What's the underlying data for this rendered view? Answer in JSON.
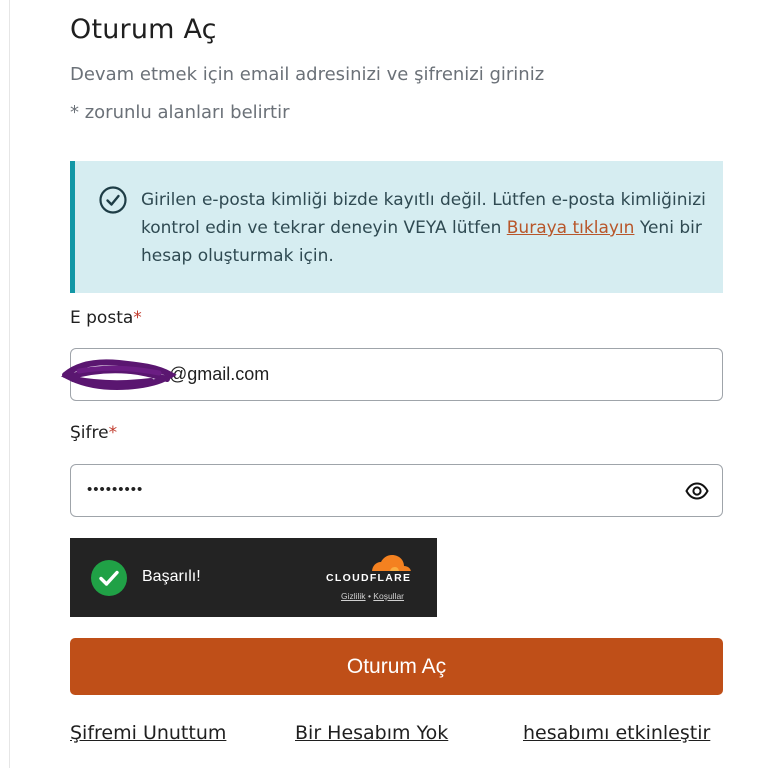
{
  "page": {
    "title": "Oturum Aç",
    "subtitle": "Devam etmek için email adresinizi ve şifrenizi giriniz",
    "required_note": "* zorunlu alanları belirtir"
  },
  "alert": {
    "icon": "check-circle-icon",
    "text_before": "Girilen e-posta kimliği bizde kayıtlı değil. Lütfen e-posta kimliğinizi kontrol edin ve tekrar deneyin VEYA lütfen ",
    "link_text": "Buraya tıklayın",
    "text_after": " Yeni bir hesap oluşturmak için.",
    "colors": {
      "background": "#d6edf1",
      "border": "#1297a6",
      "link": "#b8562a"
    }
  },
  "form": {
    "email_label": "E posta",
    "email_value": "@gmail.com",
    "password_label": "Şifre",
    "password_value": "•••••••••",
    "required_marker": "*",
    "eye_icon": "eye-icon"
  },
  "captcha": {
    "status": "Başarılı!",
    "brand": "CLOUDFLARE",
    "privacy_link": "Gizlilik",
    "separator": "•",
    "terms_link": "Koşullar",
    "colors": {
      "background": "#232323",
      "check": "#20a146",
      "cloud": "#f48120"
    }
  },
  "actions": {
    "submit_label": "Oturum Aç",
    "submit_color": "#bf4f18"
  },
  "footer": {
    "forgot_password": "Şifremi Unuttum",
    "no_account": "Bir Hesabım Yok",
    "activate_account": "hesabımı etkinleştir"
  }
}
